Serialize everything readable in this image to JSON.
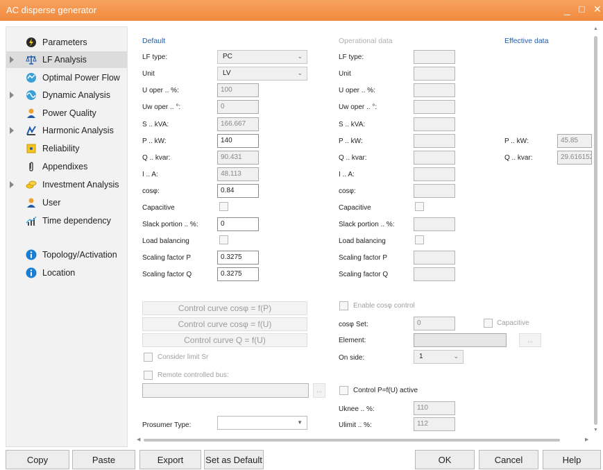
{
  "window": {
    "title": "AC disperse generator",
    "minimize": "_",
    "maximize": "□",
    "close": "✕"
  },
  "sidebar": {
    "items": [
      {
        "label": "Parameters"
      },
      {
        "label": "LF Analysis"
      },
      {
        "label": "Optimal Power Flow"
      },
      {
        "label": "Dynamic Analysis"
      },
      {
        "label": "Power Quality"
      },
      {
        "label": "Harmonic Analysis"
      },
      {
        "label": "Reliability"
      },
      {
        "label": "Appendixes"
      },
      {
        "label": "Investment Analysis"
      },
      {
        "label": "User"
      },
      {
        "label": "Time dependency"
      },
      {
        "label": "Topology/Activation"
      },
      {
        "label": "Location"
      }
    ],
    "selected": "LF Analysis"
  },
  "headers": {
    "default": "Default",
    "operational": "Operational data",
    "effective": "Effective data"
  },
  "default": {
    "lf_type_label": "LF type:",
    "lf_type_value": "PC",
    "unit_label": "Unit",
    "unit_value": "LV",
    "uoper_label": "U oper .. %:",
    "uoper_value": "100",
    "uwoper_label": "Uw oper .. °:",
    "uwoper_value": "0",
    "s_label": "S .. kVA:",
    "s_value": "166.667",
    "p_label": "P .. kW:",
    "p_value": "140",
    "q_label": "Q .. kvar:",
    "q_value": "90.431",
    "i_label": "I .. A:",
    "i_value": "48.113",
    "cos_label": "cosφ:",
    "cos_value": "0.84",
    "capacitive_label": "Capacitive",
    "slack_label": "Slack portion .. %:",
    "slack_value": "0",
    "load_bal_label": "Load balancing",
    "sfp_label": "Scaling factor P",
    "sfp_value": "0.3275",
    "sfq_label": "Scaling factor Q",
    "sfq_value": "0.3275"
  },
  "operational": {
    "lf_type_label": "LF type:",
    "unit_label": "Unit",
    "uoper_label": "U oper .. %:",
    "uwoper_label": "Uw oper .. °:",
    "s_label": "S .. kVA:",
    "p_label": "P .. kW:",
    "q_label": "Q .. kvar:",
    "i_label": "I .. A:",
    "cos_label": "cosφ:",
    "capacitive_label": "Capacitive",
    "slack_label": "Slack portion .. %:",
    "load_bal_label": "Load balancing",
    "sfp_label": "Scaling factor P",
    "sfq_label": "Scaling factor Q"
  },
  "effective": {
    "p_label": "P .. kW:",
    "p_value": "45.85",
    "q_label": "Q .. kvar:",
    "q_value": "29.616152"
  },
  "control": {
    "curve_p": "Control curve cosφ = f(P)",
    "curve_u": "Control curve cosφ = f(U)",
    "curve_q": "Control curve Q = f(U)",
    "consider_limit": "Consider limit Sr",
    "remote_bus": "Remote controlled bus:",
    "ellipsis": "...",
    "enable_cos": "Enable cosφ control",
    "cos_set_label": "cosφ Set:",
    "cos_set_value": "0",
    "capacitive_label": "Capacitive",
    "element_label": "Element:",
    "on_side_label": "On side:",
    "on_side_value": "1",
    "pfu_label": "Control P=f(U) active",
    "uknee_label": "Uknee .. %:",
    "uknee_value": "110",
    "ulimit_label": "Ulimit .. %:",
    "ulimit_value": "112",
    "prosumer_label": "Prosumer  Type:"
  },
  "buttons": {
    "copy": "Copy",
    "paste": "Paste",
    "export": "Export",
    "set_default": "Set as Default",
    "ok": "OK",
    "cancel": "Cancel",
    "help": "Help"
  },
  "colors": {
    "titlebar": "#f18a3d",
    "accent_blue": "#1f5aa8"
  }
}
